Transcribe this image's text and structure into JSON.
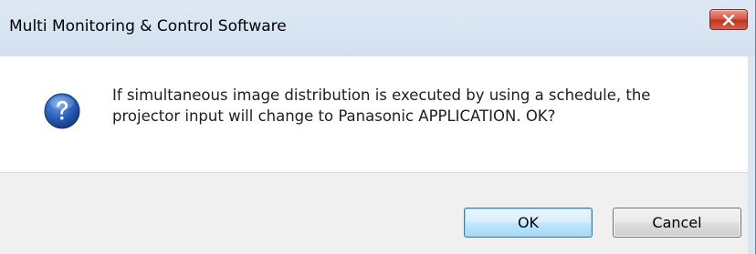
{
  "window": {
    "title": "Multi Monitoring & Control Software",
    "close_icon": "close-icon"
  },
  "dialog": {
    "icon": "question-icon",
    "message_line1": "If simultaneous image distribution is executed by using a schedule, the",
    "message_line2": "projector input will change to Panasonic APPLICATION. OK?"
  },
  "buttons": {
    "ok_label": "OK",
    "cancel_label": "Cancel"
  },
  "colors": {
    "titlebar": "#d2e0ef",
    "close_button": "#c3321f",
    "footer": "#f0f0f0",
    "ok_border": "#3c7fb1",
    "question_icon": "#1f4f9d"
  }
}
